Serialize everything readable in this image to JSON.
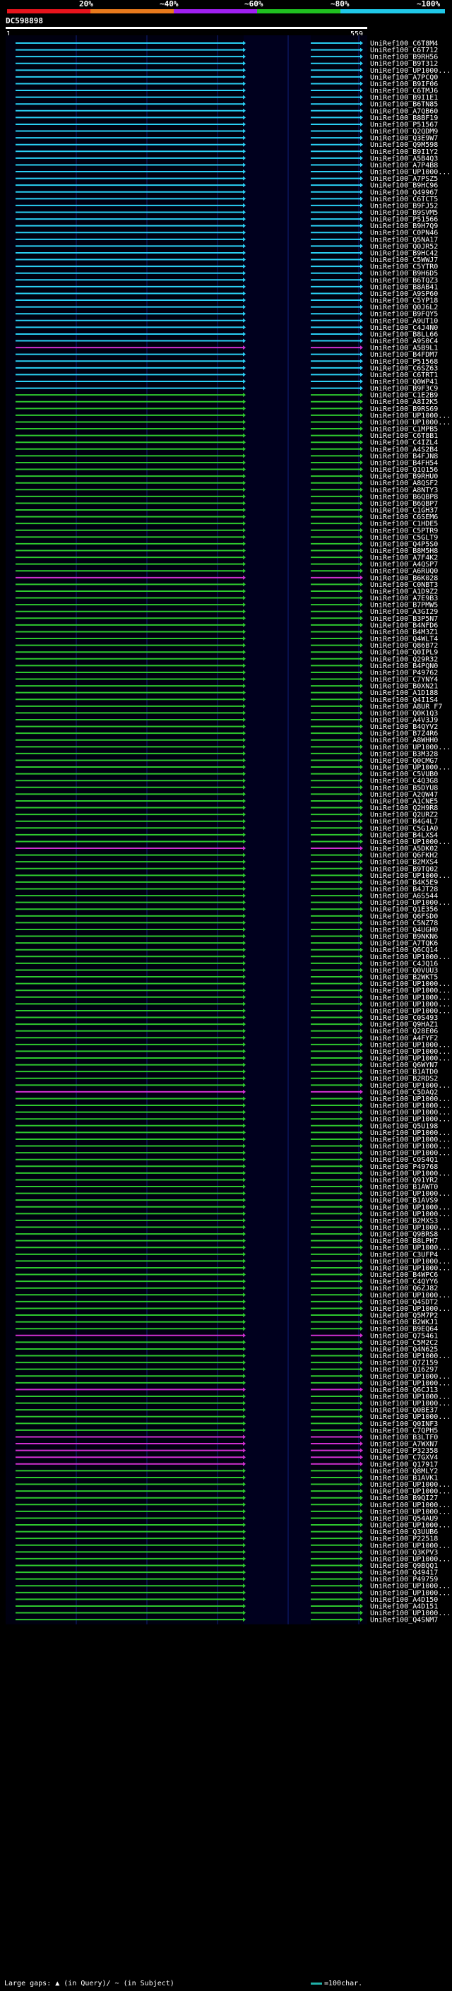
{
  "scale": {
    "colors": [
      "#e8141c",
      "#e87a1c",
      "#a020f0",
      "#20c020",
      "#20c8e8"
    ],
    "labels": [
      "20%",
      "~40%",
      "~60%",
      "~80%",
      "~100%"
    ]
  },
  "query": {
    "name": "DC598898",
    "start": "1",
    "end": "559"
  },
  "identity_colors": {
    "cyan": "#2ad0f5",
    "green": "#2ec82e",
    "magenta": "#d030d0"
  },
  "hits": [
    {
      "id": "UniRef100_C6T8M4",
      "c": "cyan"
    },
    {
      "id": "UniRef100_C6T712",
      "c": "cyan"
    },
    {
      "id": "UniRef100_B9RH56",
      "c": "cyan"
    },
    {
      "id": "UniRef100_B9T312",
      "c": "cyan"
    },
    {
      "id": "UniRef100_UP1000...",
      "c": "cyan"
    },
    {
      "id": "UniRef100_A7PCQ0",
      "c": "cyan"
    },
    {
      "id": "UniRef100_B9IF06",
      "c": "cyan"
    },
    {
      "id": "UniRef100_C6TMJ6",
      "c": "cyan"
    },
    {
      "id": "UniRef100_B9I1E1",
      "c": "cyan"
    },
    {
      "id": "UniRef100_B6TN85",
      "c": "cyan"
    },
    {
      "id": "UniRef100_A7QB60",
      "c": "cyan"
    },
    {
      "id": "UniRef100_B8BF19",
      "c": "cyan"
    },
    {
      "id": "UniRef100_P51567",
      "c": "cyan"
    },
    {
      "id": "UniRef100_Q2QDM9",
      "c": "cyan"
    },
    {
      "id": "UniRef100_Q3E9W7",
      "c": "cyan"
    },
    {
      "id": "UniRef100_Q9M598",
      "c": "cyan"
    },
    {
      "id": "UniRef100_B9I1Y2",
      "c": "cyan"
    },
    {
      "id": "UniRef100_A5B4Q3",
      "c": "cyan"
    },
    {
      "id": "UniRef100_A7P4B8",
      "c": "cyan"
    },
    {
      "id": "UniRef100_UP1000...",
      "c": "cyan"
    },
    {
      "id": "UniRef100_A7PSZ5",
      "c": "cyan"
    },
    {
      "id": "UniRef100_B9HC96",
      "c": "cyan"
    },
    {
      "id": "UniRef100_Q49967",
      "c": "cyan"
    },
    {
      "id": "UniRef100_C6TCT5",
      "c": "cyan"
    },
    {
      "id": "UniRef100_B9FJ52",
      "c": "cyan"
    },
    {
      "id": "UniRef100_B9SVM5",
      "c": "cyan"
    },
    {
      "id": "UniRef100_P51566",
      "c": "cyan"
    },
    {
      "id": "UniRef100_B9H7Q9",
      "c": "cyan"
    },
    {
      "id": "UniRef100_C0PN46",
      "c": "cyan"
    },
    {
      "id": "UniRef100_Q5NA17",
      "c": "cyan"
    },
    {
      "id": "UniRef100_Q0JR52",
      "c": "cyan"
    },
    {
      "id": "UniRef100_B9HC42",
      "c": "cyan"
    },
    {
      "id": "UniRef100_C5WWJ7",
      "c": "cyan"
    },
    {
      "id": "UniRef100_C5YTR0",
      "c": "cyan"
    },
    {
      "id": "UniRef100_B9H6D5",
      "c": "cyan"
    },
    {
      "id": "UniRef100_B6TQZ3",
      "c": "cyan"
    },
    {
      "id": "UniRef100_B8AB41",
      "c": "cyan"
    },
    {
      "id": "UniRef100_A9SP60",
      "c": "cyan"
    },
    {
      "id": "UniRef100_C5YP18",
      "c": "cyan"
    },
    {
      "id": "UniRef100_Q0J6L2",
      "c": "cyan"
    },
    {
      "id": "UniRef100_B9FQY5",
      "c": "cyan"
    },
    {
      "id": "UniRef100_A9UT10",
      "c": "cyan"
    },
    {
      "id": "UniRef100_C4J4N0",
      "c": "cyan"
    },
    {
      "id": "UniRef100_B8LL66",
      "c": "cyan"
    },
    {
      "id": "UniRef100_A9S0C4",
      "c": "cyan"
    },
    {
      "id": "UniRef100_A5B9L1",
      "c": "magenta"
    },
    {
      "id": "UniRef100_B4FDM7",
      "c": "cyan"
    },
    {
      "id": "UniRef100_P51568",
      "c": "cyan"
    },
    {
      "id": "UniRef100_C6SZ63",
      "c": "cyan"
    },
    {
      "id": "UniRef100_C6TRT1",
      "c": "cyan"
    },
    {
      "id": "UniRef100_Q0WP41",
      "c": "cyan"
    },
    {
      "id": "UniRef100_B9F3C9",
      "c": "cyan"
    },
    {
      "id": "UniRef100_C1E2B9",
      "c": "green"
    },
    {
      "id": "UniRef100_A8I2K5",
      "c": "green"
    },
    {
      "id": "UniRef100_B9RS69",
      "c": "green"
    },
    {
      "id": "UniRef100_UP1000...",
      "c": "green"
    },
    {
      "id": "UniRef100_UP1000...",
      "c": "green"
    },
    {
      "id": "UniRef100_C1MPB5",
      "c": "green"
    },
    {
      "id": "UniRef100_C6T8B1",
      "c": "green"
    },
    {
      "id": "UniRef100_C4IZL4",
      "c": "green"
    },
    {
      "id": "UniRef100_A4S2B4",
      "c": "green"
    },
    {
      "id": "UniRef100_B4FJN8",
      "c": "green"
    },
    {
      "id": "UniRef100_B4FH54",
      "c": "green"
    },
    {
      "id": "UniRef100_Q1Q156",
      "c": "green"
    },
    {
      "id": "UniRef100_B9RHU0",
      "c": "green"
    },
    {
      "id": "UniRef100_A8QSF2",
      "c": "green"
    },
    {
      "id": "UniRef100_A8NTY3",
      "c": "green"
    },
    {
      "id": "UniRef100_B6QBP8",
      "c": "green"
    },
    {
      "id": "UniRef100_B6QBP7",
      "c": "green"
    },
    {
      "id": "UniRef100_C1GH37",
      "c": "green"
    },
    {
      "id": "UniRef100_C6SEM6",
      "c": "green"
    },
    {
      "id": "UniRef100_C1HDE5",
      "c": "green"
    },
    {
      "id": "UniRef100_C5PTR9",
      "c": "green"
    },
    {
      "id": "UniRef100_C5GLT9",
      "c": "green"
    },
    {
      "id": "UniRef100_Q4P5S0",
      "c": "green"
    },
    {
      "id": "UniRef100_B8M5H8",
      "c": "green"
    },
    {
      "id": "UniRef100_A7F4K2",
      "c": "green"
    },
    {
      "id": "UniRef100_A4QSP7",
      "c": "green"
    },
    {
      "id": "UniRef100_A6RUQ0",
      "c": "green"
    },
    {
      "id": "UniRef100_B6K028",
      "c": "magenta"
    },
    {
      "id": "UniRef100_C0NBT3",
      "c": "green"
    },
    {
      "id": "UniRef100_A1D9Z2",
      "c": "green"
    },
    {
      "id": "UniRef100_A7E9B3",
      "c": "green"
    },
    {
      "id": "UniRef100_B7PMW5",
      "c": "green"
    },
    {
      "id": "UniRef100_A3GI29",
      "c": "green"
    },
    {
      "id": "UniRef100_B3P5N7",
      "c": "green"
    },
    {
      "id": "UniRef100_B4NFD6",
      "c": "green"
    },
    {
      "id": "UniRef100_B4M3Z1",
      "c": "green"
    },
    {
      "id": "UniRef100_Q4WLT4",
      "c": "green"
    },
    {
      "id": "UniRef100_Q86B72",
      "c": "green"
    },
    {
      "id": "UniRef100_Q0IPL9",
      "c": "green"
    },
    {
      "id": "UniRef100_Q29R32",
      "c": "green"
    },
    {
      "id": "UniRef100_B4PQN0",
      "c": "green"
    },
    {
      "id": "UniRef100_P49762",
      "c": "green"
    },
    {
      "id": "UniRef100_C7YNY4",
      "c": "green"
    },
    {
      "id": "UniRef100_B0XN21",
      "c": "green"
    },
    {
      "id": "UniRef100_A1D188",
      "c": "green"
    },
    {
      "id": "UniRef100_Q4I1S4",
      "c": "green"
    },
    {
      "id": "UniRef100_A8UR F7",
      "c": "green"
    },
    {
      "id": "UniRef100_Q0K1Q3",
      "c": "green"
    },
    {
      "id": "UniRef100_A4V3J9",
      "c": "green"
    },
    {
      "id": "UniRef100_B4QYV2",
      "c": "green"
    },
    {
      "id": "UniRef100_B7Z4R6",
      "c": "green"
    },
    {
      "id": "UniRef100_A8WHH0",
      "c": "green"
    },
    {
      "id": "UniRef100_UP1000...",
      "c": "green"
    },
    {
      "id": "UniRef100_B3M328",
      "c": "green"
    },
    {
      "id": "UniRef100_Q0CMG7",
      "c": "green"
    },
    {
      "id": "UniRef100_UP1000...",
      "c": "green"
    },
    {
      "id": "UniRef100_C5VUB0",
      "c": "green"
    },
    {
      "id": "UniRef100_C4Q3G8",
      "c": "green"
    },
    {
      "id": "UniRef100_B5DYU8",
      "c": "green"
    },
    {
      "id": "UniRef100_A2QW47",
      "c": "green"
    },
    {
      "id": "UniRef100_A1CNE5",
      "c": "green"
    },
    {
      "id": "UniRef100_Q2H9R8",
      "c": "green"
    },
    {
      "id": "UniRef100_Q2URZ2",
      "c": "green"
    },
    {
      "id": "UniRef100_B4G4L7",
      "c": "green"
    },
    {
      "id": "UniRef100_C5G1A0",
      "c": "green"
    },
    {
      "id": "UniRef100_B4LXS4",
      "c": "green"
    },
    {
      "id": "UniRef100_UP1000...",
      "c": "green"
    },
    {
      "id": "UniRef100_A5DK02",
      "c": "magenta"
    },
    {
      "id": "UniRef100_Q6FKH2",
      "c": "green"
    },
    {
      "id": "UniRef100_B2MXS4",
      "c": "green"
    },
    {
      "id": "UniRef100_B9TQ02",
      "c": "green"
    },
    {
      "id": "UniRef100_UP1000...",
      "c": "green"
    },
    {
      "id": "UniRef100_B4K5E9",
      "c": "green"
    },
    {
      "id": "UniRef100_B4JT28",
      "c": "green"
    },
    {
      "id": "UniRef100_A6S544",
      "c": "green"
    },
    {
      "id": "UniRef100_UP1000...",
      "c": "green"
    },
    {
      "id": "UniRef100_Q1E356",
      "c": "green"
    },
    {
      "id": "UniRef100_Q6FSD0",
      "c": "green"
    },
    {
      "id": "UniRef100_C5NZ78",
      "c": "green"
    },
    {
      "id": "UniRef100_Q4UGH0",
      "c": "green"
    },
    {
      "id": "UniRef100_B9NKN6",
      "c": "green"
    },
    {
      "id": "UniRef100_A7TQK6",
      "c": "green"
    },
    {
      "id": "UniRef100_Q6CQ14",
      "c": "green"
    },
    {
      "id": "UniRef100_UP1000...",
      "c": "green"
    },
    {
      "id": "UniRef100_C4JQ16",
      "c": "green"
    },
    {
      "id": "UniRef100_Q0VUU3",
      "c": "green"
    },
    {
      "id": "UniRef100_B2WKT5",
      "c": "green"
    },
    {
      "id": "UniRef100_UP1000...",
      "c": "green"
    },
    {
      "id": "UniRef100_UP1000...",
      "c": "green"
    },
    {
      "id": "UniRef100_UP1000...",
      "c": "green"
    },
    {
      "id": "UniRef100_UP1000...",
      "c": "green"
    },
    {
      "id": "UniRef100_UP1000...",
      "c": "green"
    },
    {
      "id": "UniRef100_C0S493",
      "c": "green"
    },
    {
      "id": "UniRef100_Q9HAZ1",
      "c": "green"
    },
    {
      "id": "UniRef100_Q28E06",
      "c": "green"
    },
    {
      "id": "UniRef100_A4FYF2",
      "c": "green"
    },
    {
      "id": "UniRef100_UP1000...",
      "c": "green"
    },
    {
      "id": "UniRef100_UP1000...",
      "c": "green"
    },
    {
      "id": "UniRef100_UP1000...",
      "c": "green"
    },
    {
      "id": "UniRef100_Q6WYN7",
      "c": "green"
    },
    {
      "id": "UniRef100_B1ATD0",
      "c": "green"
    },
    {
      "id": "UniRef100_B2RDS2",
      "c": "green"
    },
    {
      "id": "UniRef100_UP1000...",
      "c": "green"
    },
    {
      "id": "UniRef100_C5DAQ2",
      "c": "magenta"
    },
    {
      "id": "UniRef100_UP1000...",
      "c": "green"
    },
    {
      "id": "UniRef100_UP1000...",
      "c": "green"
    },
    {
      "id": "UniRef100_UP1000...",
      "c": "green"
    },
    {
      "id": "UniRef100_UP1000...",
      "c": "green"
    },
    {
      "id": "UniRef100_Q5U198",
      "c": "green"
    },
    {
      "id": "UniRef100_UP1000...",
      "c": "green"
    },
    {
      "id": "UniRef100_UP1000...",
      "c": "green"
    },
    {
      "id": "UniRef100_UP1000...",
      "c": "green"
    },
    {
      "id": "UniRef100_UP1000...",
      "c": "green"
    },
    {
      "id": "UniRef100_C0S4Q1",
      "c": "green"
    },
    {
      "id": "UniRef100_P49768",
      "c": "green"
    },
    {
      "id": "UniRef100_UP1000...",
      "c": "green"
    },
    {
      "id": "UniRef100_Q91YR2",
      "c": "green"
    },
    {
      "id": "UniRef100_B1AWT0",
      "c": "green"
    },
    {
      "id": "UniRef100_UP1000...",
      "c": "green"
    },
    {
      "id": "UniRef100_B1AVS9",
      "c": "green"
    },
    {
      "id": "UniRef100_UP1000...",
      "c": "green"
    },
    {
      "id": "UniRef100_UP1000...",
      "c": "green"
    },
    {
      "id": "UniRef100_B2MXS3",
      "c": "green"
    },
    {
      "id": "UniRef100_UP1000...",
      "c": "green"
    },
    {
      "id": "UniRef100_Q9BRS8",
      "c": "green"
    },
    {
      "id": "UniRef100_B8LPH7",
      "c": "green"
    },
    {
      "id": "UniRef100_UP1000...",
      "c": "green"
    },
    {
      "id": "UniRef100_C3UFP4",
      "c": "green"
    },
    {
      "id": "UniRef100_UP1000...",
      "c": "green"
    },
    {
      "id": "UniRef100_UP1000...",
      "c": "green"
    },
    {
      "id": "UniRef100_B4WPC6",
      "c": "green"
    },
    {
      "id": "UniRef100_C4QYY6",
      "c": "green"
    },
    {
      "id": "UniRef100_Q6ZJ82",
      "c": "green"
    },
    {
      "id": "UniRef100_UP1000...",
      "c": "green"
    },
    {
      "id": "UniRef100_Q4SDT2",
      "c": "green"
    },
    {
      "id": "UniRef100_UP1000...",
      "c": "green"
    },
    {
      "id": "UniRef100_Q5M7P2",
      "c": "green"
    },
    {
      "id": "UniRef100_B2WKJ1",
      "c": "green"
    },
    {
      "id": "UniRef100_B9EQ64",
      "c": "green"
    },
    {
      "id": "UniRef100_Q75461",
      "c": "magenta"
    },
    {
      "id": "UniRef100_C5M2C2",
      "c": "green"
    },
    {
      "id": "UniRef100_Q4N625",
      "c": "green"
    },
    {
      "id": "UniRef100_UP1000...",
      "c": "green"
    },
    {
      "id": "UniRef100_Q7Z159",
      "c": "green"
    },
    {
      "id": "UniRef100_Q16297",
      "c": "green"
    },
    {
      "id": "UniRef100_UP1000...",
      "c": "green"
    },
    {
      "id": "UniRef100_UP1000...",
      "c": "green"
    },
    {
      "id": "UniRef100_Q6CJ13",
      "c": "magenta"
    },
    {
      "id": "UniRef100_UP1000...",
      "c": "green"
    },
    {
      "id": "UniRef100_UP1000...",
      "c": "green"
    },
    {
      "id": "UniRef100_Q0BE37",
      "c": "green"
    },
    {
      "id": "UniRef100_UP1000...",
      "c": "green"
    },
    {
      "id": "UniRef100_Q0INF3",
      "c": "green"
    },
    {
      "id": "UniRef100_C7QPH5",
      "c": "green"
    },
    {
      "id": "UniRef100_B3LTF0",
      "c": "magenta"
    },
    {
      "id": "UniRef100_A7WXN7",
      "c": "magenta"
    },
    {
      "id": "UniRef100_P32358",
      "c": "magenta"
    },
    {
      "id": "UniRef100_C7GXV4",
      "c": "magenta"
    },
    {
      "id": "UniRef100_Q17917",
      "c": "magenta"
    },
    {
      "id": "UniRef100_Q8MLY2",
      "c": "green"
    },
    {
      "id": "UniRef100_B1AVK1",
      "c": "green"
    },
    {
      "id": "UniRef100_UP1000...",
      "c": "green"
    },
    {
      "id": "UniRef100_UP1000...",
      "c": "green"
    },
    {
      "id": "UniRef100_B9QI27",
      "c": "green"
    },
    {
      "id": "UniRef100_UP1000...",
      "c": "green"
    },
    {
      "id": "UniRef100_UP1000...",
      "c": "green"
    },
    {
      "id": "UniRef100_Q54AU9",
      "c": "green"
    },
    {
      "id": "UniRef100_UP1000...",
      "c": "green"
    },
    {
      "id": "UniRef100_Q3UUB6",
      "c": "green"
    },
    {
      "id": "UniRef100_P22518",
      "c": "green"
    },
    {
      "id": "UniRef100_UP1000...",
      "c": "green"
    },
    {
      "id": "UniRef100_Q3KPV3",
      "c": "green"
    },
    {
      "id": "UniRef100_UP1000...",
      "c": "green"
    },
    {
      "id": "UniRef100_Q9BQQ1",
      "c": "green"
    },
    {
      "id": "UniRef100_Q49417",
      "c": "green"
    },
    {
      "id": "UniRef100_P49759",
      "c": "green"
    },
    {
      "id": "UniRef100_UP1000...",
      "c": "green"
    },
    {
      "id": "UniRef100_UP1000...",
      "c": "green"
    },
    {
      "id": "UniRef100_A4D150",
      "c": "green"
    },
    {
      "id": "UniRef100_A4D151",
      "c": "green"
    },
    {
      "id": "UniRef100_UP1000...",
      "c": "green"
    },
    {
      "id": "UniRef100_Q4SNM7",
      "c": "green"
    }
  ],
  "footer": {
    "gaps_text": "Large gaps: ▲ (in Query)/ ~ (in Subject)",
    "legend_text": "=100char."
  }
}
